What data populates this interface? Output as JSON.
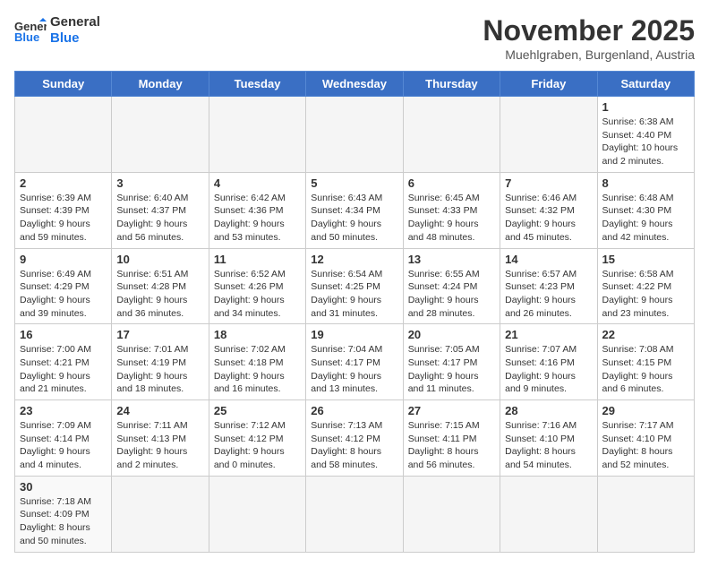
{
  "header": {
    "logo_general": "General",
    "logo_blue": "Blue",
    "month_title": "November 2025",
    "location": "Muehlgraben, Burgenland, Austria"
  },
  "weekdays": [
    "Sunday",
    "Monday",
    "Tuesday",
    "Wednesday",
    "Thursday",
    "Friday",
    "Saturday"
  ],
  "days": {
    "d1": {
      "num": "1",
      "sunrise": "Sunrise: 6:38 AM",
      "sunset": "Sunset: 4:40 PM",
      "daylight": "Daylight: 10 hours and 2 minutes."
    },
    "d2": {
      "num": "2",
      "sunrise": "Sunrise: 6:39 AM",
      "sunset": "Sunset: 4:39 PM",
      "daylight": "Daylight: 9 hours and 59 minutes."
    },
    "d3": {
      "num": "3",
      "sunrise": "Sunrise: 6:40 AM",
      "sunset": "Sunset: 4:37 PM",
      "daylight": "Daylight: 9 hours and 56 minutes."
    },
    "d4": {
      "num": "4",
      "sunrise": "Sunrise: 6:42 AM",
      "sunset": "Sunset: 4:36 PM",
      "daylight": "Daylight: 9 hours and 53 minutes."
    },
    "d5": {
      "num": "5",
      "sunrise": "Sunrise: 6:43 AM",
      "sunset": "Sunset: 4:34 PM",
      "daylight": "Daylight: 9 hours and 50 minutes."
    },
    "d6": {
      "num": "6",
      "sunrise": "Sunrise: 6:45 AM",
      "sunset": "Sunset: 4:33 PM",
      "daylight": "Daylight: 9 hours and 48 minutes."
    },
    "d7": {
      "num": "7",
      "sunrise": "Sunrise: 6:46 AM",
      "sunset": "Sunset: 4:32 PM",
      "daylight": "Daylight: 9 hours and 45 minutes."
    },
    "d8": {
      "num": "8",
      "sunrise": "Sunrise: 6:48 AM",
      "sunset": "Sunset: 4:30 PM",
      "daylight": "Daylight: 9 hours and 42 minutes."
    },
    "d9": {
      "num": "9",
      "sunrise": "Sunrise: 6:49 AM",
      "sunset": "Sunset: 4:29 PM",
      "daylight": "Daylight: 9 hours and 39 minutes."
    },
    "d10": {
      "num": "10",
      "sunrise": "Sunrise: 6:51 AM",
      "sunset": "Sunset: 4:28 PM",
      "daylight": "Daylight: 9 hours and 36 minutes."
    },
    "d11": {
      "num": "11",
      "sunrise": "Sunrise: 6:52 AM",
      "sunset": "Sunset: 4:26 PM",
      "daylight": "Daylight: 9 hours and 34 minutes."
    },
    "d12": {
      "num": "12",
      "sunrise": "Sunrise: 6:54 AM",
      "sunset": "Sunset: 4:25 PM",
      "daylight": "Daylight: 9 hours and 31 minutes."
    },
    "d13": {
      "num": "13",
      "sunrise": "Sunrise: 6:55 AM",
      "sunset": "Sunset: 4:24 PM",
      "daylight": "Daylight: 9 hours and 28 minutes."
    },
    "d14": {
      "num": "14",
      "sunrise": "Sunrise: 6:57 AM",
      "sunset": "Sunset: 4:23 PM",
      "daylight": "Daylight: 9 hours and 26 minutes."
    },
    "d15": {
      "num": "15",
      "sunrise": "Sunrise: 6:58 AM",
      "sunset": "Sunset: 4:22 PM",
      "daylight": "Daylight: 9 hours and 23 minutes."
    },
    "d16": {
      "num": "16",
      "sunrise": "Sunrise: 7:00 AM",
      "sunset": "Sunset: 4:21 PM",
      "daylight": "Daylight: 9 hours and 21 minutes."
    },
    "d17": {
      "num": "17",
      "sunrise": "Sunrise: 7:01 AM",
      "sunset": "Sunset: 4:19 PM",
      "daylight": "Daylight: 9 hours and 18 minutes."
    },
    "d18": {
      "num": "18",
      "sunrise": "Sunrise: 7:02 AM",
      "sunset": "Sunset: 4:18 PM",
      "daylight": "Daylight: 9 hours and 16 minutes."
    },
    "d19": {
      "num": "19",
      "sunrise": "Sunrise: 7:04 AM",
      "sunset": "Sunset: 4:17 PM",
      "daylight": "Daylight: 9 hours and 13 minutes."
    },
    "d20": {
      "num": "20",
      "sunrise": "Sunrise: 7:05 AM",
      "sunset": "Sunset: 4:17 PM",
      "daylight": "Daylight: 9 hours and 11 minutes."
    },
    "d21": {
      "num": "21",
      "sunrise": "Sunrise: 7:07 AM",
      "sunset": "Sunset: 4:16 PM",
      "daylight": "Daylight: 9 hours and 9 minutes."
    },
    "d22": {
      "num": "22",
      "sunrise": "Sunrise: 7:08 AM",
      "sunset": "Sunset: 4:15 PM",
      "daylight": "Daylight: 9 hours and 6 minutes."
    },
    "d23": {
      "num": "23",
      "sunrise": "Sunrise: 7:09 AM",
      "sunset": "Sunset: 4:14 PM",
      "daylight": "Daylight: 9 hours and 4 minutes."
    },
    "d24": {
      "num": "24",
      "sunrise": "Sunrise: 7:11 AM",
      "sunset": "Sunset: 4:13 PM",
      "daylight": "Daylight: 9 hours and 2 minutes."
    },
    "d25": {
      "num": "25",
      "sunrise": "Sunrise: 7:12 AM",
      "sunset": "Sunset: 4:12 PM",
      "daylight": "Daylight: 9 hours and 0 minutes."
    },
    "d26": {
      "num": "26",
      "sunrise": "Sunrise: 7:13 AM",
      "sunset": "Sunset: 4:12 PM",
      "daylight": "Daylight: 8 hours and 58 minutes."
    },
    "d27": {
      "num": "27",
      "sunrise": "Sunrise: 7:15 AM",
      "sunset": "Sunset: 4:11 PM",
      "daylight": "Daylight: 8 hours and 56 minutes."
    },
    "d28": {
      "num": "28",
      "sunrise": "Sunrise: 7:16 AM",
      "sunset": "Sunset: 4:10 PM",
      "daylight": "Daylight: 8 hours and 54 minutes."
    },
    "d29": {
      "num": "29",
      "sunrise": "Sunrise: 7:17 AM",
      "sunset": "Sunset: 4:10 PM",
      "daylight": "Daylight: 8 hours and 52 minutes."
    },
    "d30": {
      "num": "30",
      "sunrise": "Sunrise: 7:18 AM",
      "sunset": "Sunset: 4:09 PM",
      "daylight": "Daylight: 8 hours and 50 minutes."
    }
  }
}
